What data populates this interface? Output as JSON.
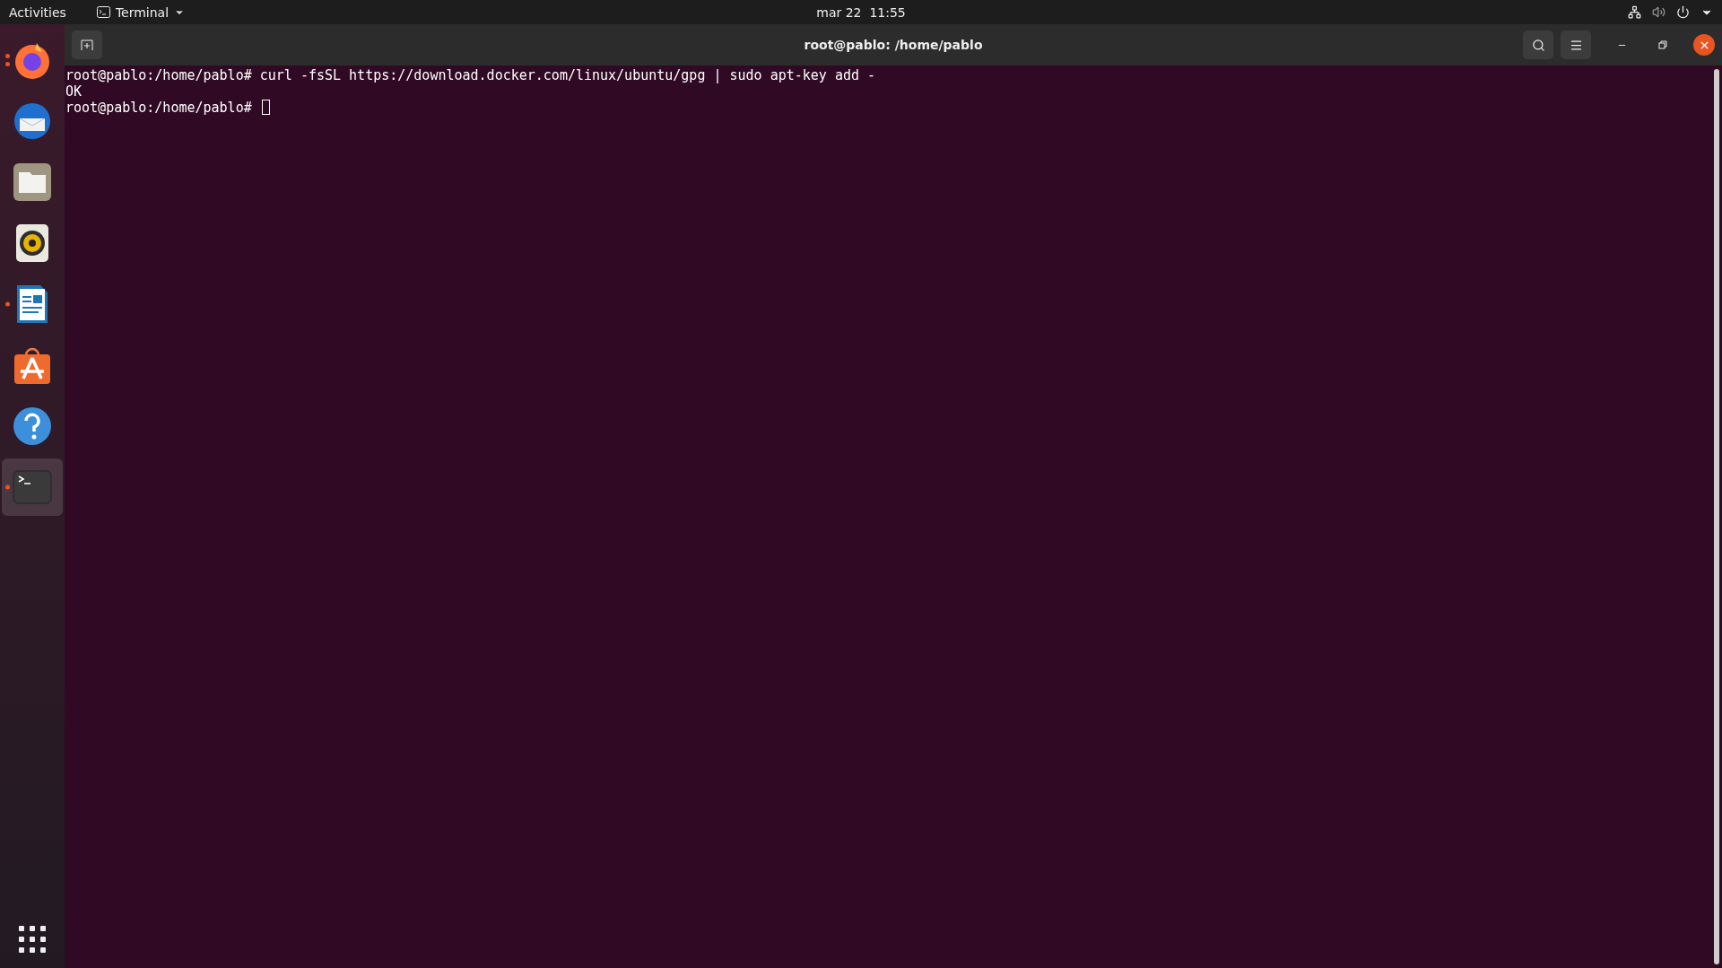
{
  "top_bar": {
    "activities": "Activities",
    "app_menu": "Terminal",
    "clock": "mar 22  11:55"
  },
  "dock": {
    "items": [
      {
        "kind": "firefox",
        "running": true,
        "multiple_windows": true,
        "selected": false
      },
      {
        "kind": "thunderbird",
        "running": false,
        "multiple_windows": false,
        "selected": false
      },
      {
        "kind": "files",
        "running": false,
        "multiple_windows": false,
        "selected": false
      },
      {
        "kind": "rhythmbox",
        "running": false,
        "multiple_windows": false,
        "selected": false
      },
      {
        "kind": "writer",
        "running": true,
        "multiple_windows": false,
        "selected": false
      },
      {
        "kind": "software",
        "running": false,
        "multiple_windows": false,
        "selected": false
      },
      {
        "kind": "help",
        "running": false,
        "multiple_windows": false,
        "selected": false
      },
      {
        "kind": "terminal",
        "running": true,
        "multiple_windows": false,
        "selected": true
      }
    ]
  },
  "window": {
    "title": "root@pablo: /home/pablo"
  },
  "terminal": {
    "lines": [
      {
        "text": "root@pablo:/home/pablo# curl -fsSL https://download.docker.com/linux/ubuntu/gpg | sudo apt-key add -",
        "cursor": false
      },
      {
        "text": "OK",
        "cursor": false
      },
      {
        "text": "root@pablo:/home/pablo# ",
        "cursor": true
      }
    ]
  }
}
